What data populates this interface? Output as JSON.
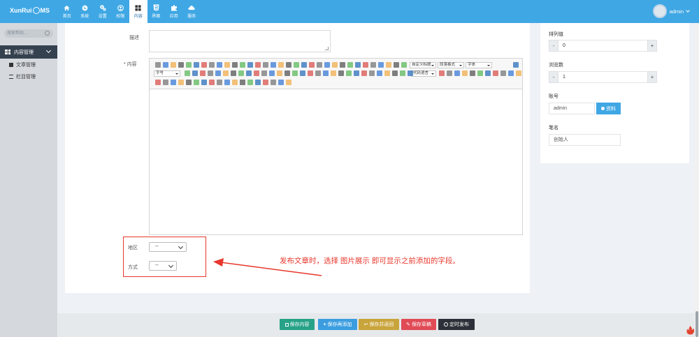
{
  "header": {
    "logo_text_a": "XunRui",
    "logo_text_b": "MS",
    "nav": [
      {
        "label": "首页",
        "icon": "home-icon"
      },
      {
        "label": "系统",
        "icon": "globe-icon"
      },
      {
        "label": "设置",
        "icon": "cogs-icon"
      },
      {
        "label": "权限",
        "icon": "user-icon"
      },
      {
        "label": "内容",
        "icon": "grid-icon",
        "active": true
      },
      {
        "label": "界面",
        "icon": "html5-icon"
      },
      {
        "label": "应用",
        "icon": "puzzle-icon"
      },
      {
        "label": "服务",
        "icon": "cloud-icon"
      }
    ],
    "user": "admin"
  },
  "sidebar": {
    "search_placeholder": "搜索帮助...",
    "active_group": "内容管理",
    "items": [
      {
        "label": "文章管理",
        "icon": "book-icon"
      },
      {
        "label": "栏目管理",
        "icon": "list-icon"
      }
    ]
  },
  "form": {
    "desc_label": "描述",
    "content_label": "* 内容",
    "editor_selects": {
      "custom_title": "自定义标题",
      "paragraph": "段落格式",
      "font": "字体",
      "font_size": "字号",
      "code_lang": "代码语言"
    },
    "region_label": "地区",
    "region_value": "--",
    "method_label": "方式",
    "method_value": "--"
  },
  "annotation": {
    "text": "发布文章时，选择 图片展示 即可显示之前添加的字段。",
    "color": "#e8372c"
  },
  "right_panel": {
    "order_label": "排列值",
    "order_value": "0",
    "views_label": "浏览数",
    "views_value": "1",
    "account_label": "账号",
    "account_value": "admin",
    "profile_button": "资料",
    "author_label": "笔名",
    "author_value": "创始人",
    "minus": "-",
    "plus": "+"
  },
  "footer": {
    "buttons": [
      {
        "label": "保存内容",
        "color": "#27a288"
      },
      {
        "label": "保存再添加",
        "color": "#3b9de0"
      },
      {
        "label": "保存并返回",
        "color": "#c9a43b"
      },
      {
        "label": "保存草稿",
        "color": "#e04b56"
      },
      {
        "label": "定时发布",
        "color": "#2c3038"
      }
    ]
  },
  "colors": {
    "topbar": "#3fa7e4",
    "sidebar": "#d5d9de",
    "sidebar_active": "#364150"
  }
}
